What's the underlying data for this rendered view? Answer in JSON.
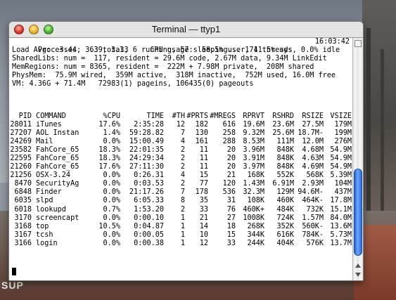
{
  "window": {
    "title": "Terminal — ttyp1"
  },
  "header": {
    "processes": "Processes:  63 total, 6 running, 57 sleeping... 171 threads",
    "time": "16:03:42",
    "load": "Load Avg:  3.44, 3.39, 3.33     CPU usage:  58.5% user, 41.5% sys, 0.0% idle",
    "shared_libs": "SharedLibs: num =  117, resident = 29.6M code, 2.67M data, 9.34M LinkEdit",
    "mem_regions": "MemRegions: num = 8365, resident =  222M + 7.98M private,  208M shared",
    "phys_mem": "PhysMem:  75.9M wired,  359M active,  318M inactive,  752M used, 16.0M free",
    "vm": "VM: 4.36G + 71.4M   72983(1) pageins, 106435(0) pageouts"
  },
  "table": {
    "columns": [
      "PID",
      "COMMAND",
      "%CPU",
      "TIME",
      "#TH",
      "#PRTS",
      "#MREGS",
      "RPRVT",
      "RSHRD",
      "RSIZE",
      "VSIZE"
    ],
    "rows": [
      [
        "28011",
        "iTunes",
        "17.6%",
        "2:35:28",
        "12",
        "182",
        "616",
        "19.6M",
        "23.6M",
        "27.5M",
        "179M"
      ],
      [
        "27207",
        "AOL Instan",
        "1.4%",
        "59:28.82",
        "7",
        "130",
        "258",
        "9.32M",
        "25.6M",
        "18.7M-",
        "199M"
      ],
      [
        "24269",
        "Mail",
        "0.0%",
        "15:00.49",
        "4",
        "161",
        "288",
        "8.53M",
        "111M",
        "12.0M",
        "276M"
      ],
      [
        "23582",
        "FahCore_65",
        "18.3%",
        "22:01:35",
        "2",
        "11",
        "20",
        "3.96M",
        "848K",
        "4.68M",
        "54.9M"
      ],
      [
        "22595",
        "FahCore_65",
        "18.3%",
        "24:29:34",
        "2",
        "11",
        "20",
        "3.91M",
        "848K",
        "4.63M",
        "54.9M"
      ],
      [
        "21260",
        "FahCore_65",
        "17.6%",
        "27:11:30",
        "2",
        "11",
        "20",
        "3.97M",
        "848K",
        "4.69M",
        "54.9M"
      ],
      [
        "21256",
        "OSX-3.24",
        "0.0%",
        "0:26.31",
        "4",
        "15",
        "21",
        "168K",
        "552K",
        "568K",
        "5.39M"
      ],
      [
        "8470",
        "SecurityAg",
        "0.0%",
        "0:03.53",
        "2",
        "77",
        "120",
        "1.43M",
        "6.91M",
        "2.93M",
        "104M"
      ],
      [
        "6848",
        "Finder",
        "0.0%",
        "21:17.26",
        "7",
        "178",
        "536",
        "32.3M",
        "129M",
        "94.6M-",
        "437M"
      ],
      [
        "6035",
        "slpd",
        "0.0%",
        "6:05.33",
        "8",
        "35",
        "31",
        "108K",
        "460K",
        "464K-",
        "17.8M"
      ],
      [
        "6018",
        "lookupd",
        "0.7%",
        "1:53.20",
        "2",
        "33",
        "76",
        "460K+",
        "484K",
        "732K",
        "15.1M"
      ],
      [
        "3170",
        "screencapt",
        "0.0%",
        "0:00.10",
        "1",
        "21",
        "27",
        "1008K",
        "724K",
        "1.57M",
        "84.0M"
      ],
      [
        "3168",
        "top",
        "10.5%",
        "0:04.87",
        "1",
        "14",
        "18",
        "268K",
        "352K",
        "560K-",
        "13.6M"
      ],
      [
        "3167",
        "tcsh",
        "0.0%",
        "0:00.05",
        "1",
        "10",
        "15",
        "344K",
        "616K",
        "784K-",
        "5.73M"
      ],
      [
        "3166",
        "login",
        "0.0%",
        "0:00.38",
        "1",
        "12",
        "33",
        "244K",
        "404K",
        "576K",
        "13.7M"
      ]
    ]
  },
  "desktop": {
    "sign_text": "SUP"
  },
  "colors": {
    "scroll_thumb": "#2a6ae0",
    "close": "#e0352a",
    "minimize": "#f0b526",
    "zoom": "#48b82a"
  }
}
